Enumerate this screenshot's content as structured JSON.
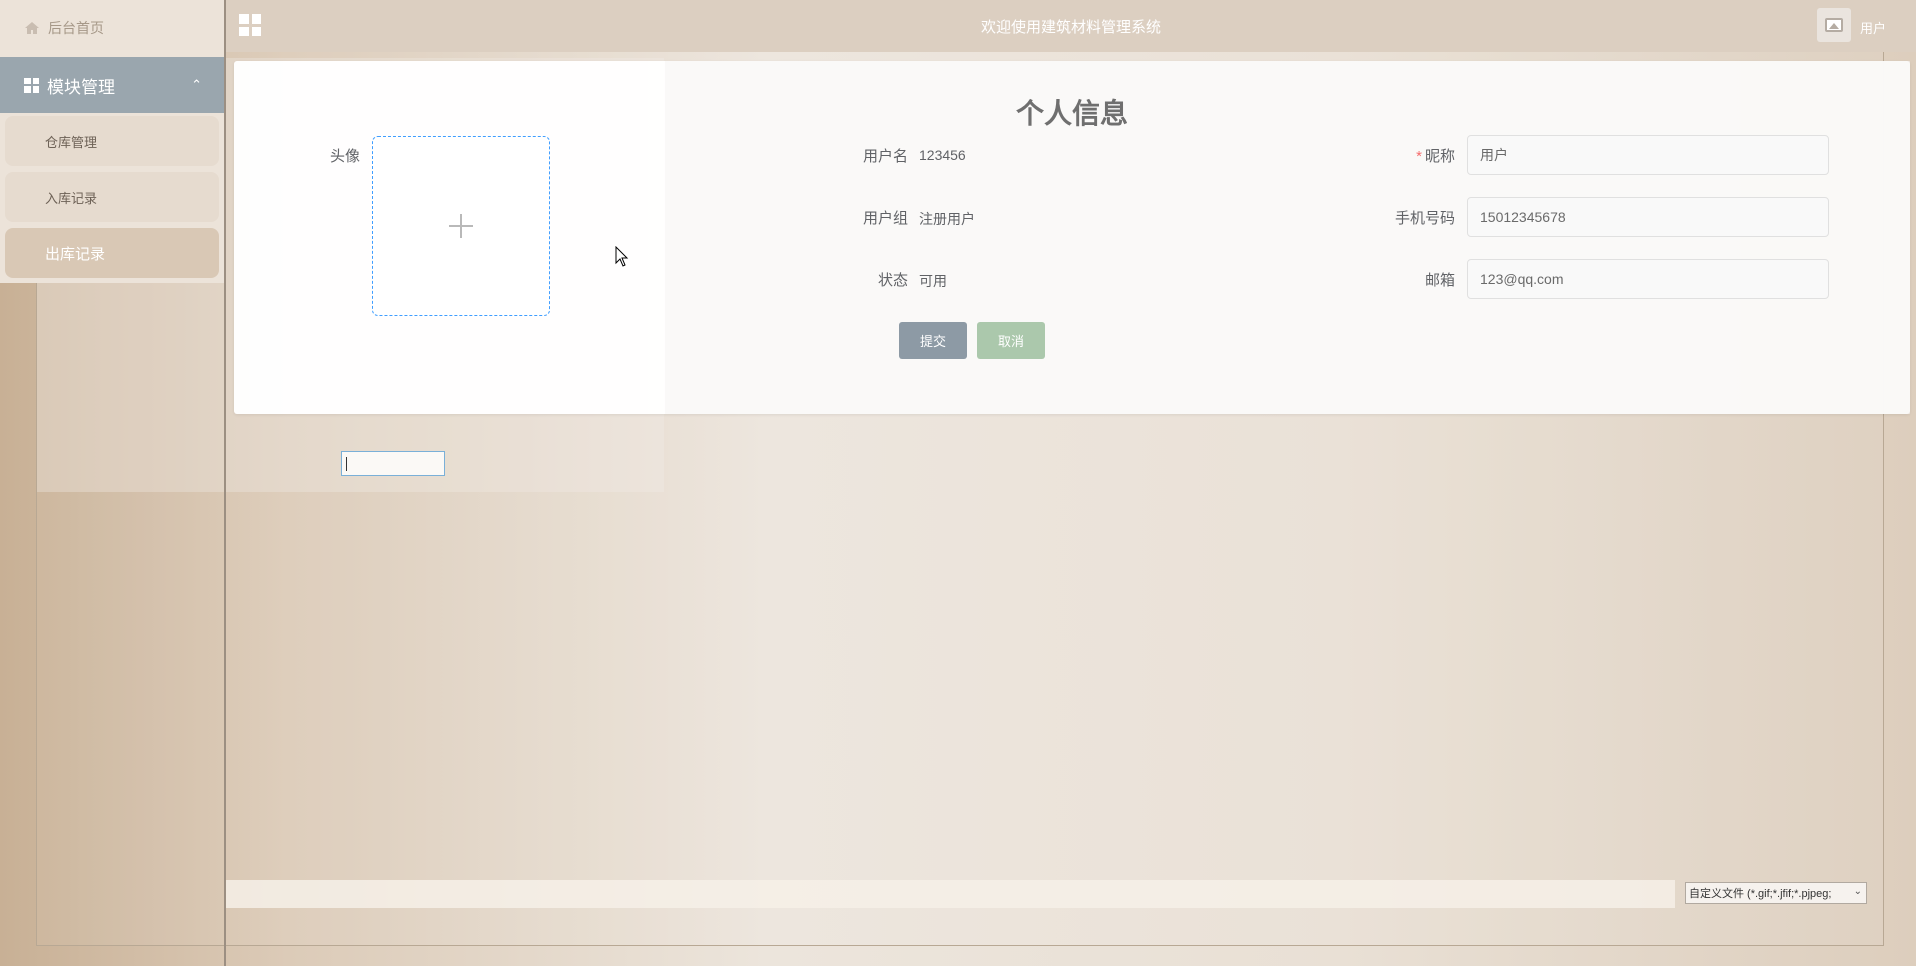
{
  "header": {
    "title": "欢迎使用建筑材料管理系统",
    "user": "用户"
  },
  "sidebar": {
    "home": "后台首页",
    "module": "模块管理",
    "items": [
      {
        "label": "仓库管理",
        "active": false
      },
      {
        "label": "入库记录",
        "active": false
      },
      {
        "label": "出库记录",
        "active": true
      }
    ]
  },
  "profile": {
    "title": "个人信息",
    "avatar_label": "头像",
    "username_label": "用户名",
    "username_value": "123456",
    "group_label": "用户组",
    "group_value": "注册用户",
    "status_label": "状态",
    "status_value": "可用",
    "nickname_label": "昵称",
    "nickname_value": "用户",
    "phone_label": "手机号码",
    "phone_value": "15012345678",
    "email_label": "邮箱",
    "email_value": "123@qq.com",
    "submit_label": "提交",
    "cancel_label": "取消"
  },
  "file_dialog": {
    "filter_value": "自定义文件 (*.gif;*.jfif;*.pjpeg;"
  },
  "colors": {
    "accent_dashed": "#409eff",
    "submit": "#8d9aa5",
    "cancel": "#abc8ac",
    "required": "#f56c6c"
  }
}
